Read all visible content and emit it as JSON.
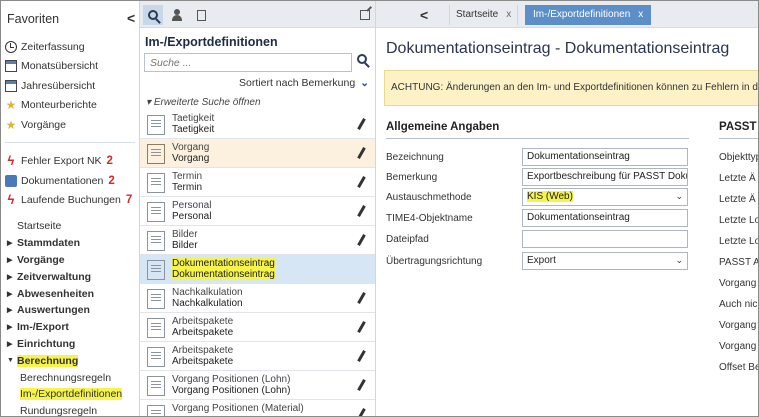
{
  "favorites": {
    "title": "Favoriten",
    "collapse": "<",
    "items": [
      {
        "label": "Zeiterfassung",
        "icon": "clock-icon"
      },
      {
        "label": "Monatsübersicht",
        "icon": "calendar-icon"
      },
      {
        "label": "Jahresübersicht",
        "icon": "calendar-icon"
      },
      {
        "label": "Monteurberichte",
        "icon": "star-icon"
      },
      {
        "label": "Vorgänge",
        "icon": "star-icon"
      }
    ],
    "alerts": [
      {
        "label": "Fehler Export NK",
        "count": "2",
        "icon": "bolt-icon"
      },
      {
        "label": "Dokumentationen",
        "count": "2",
        "icon": "documents-icon"
      },
      {
        "label": "Laufende Buchungen",
        "count": "7",
        "icon": "bolt-icon"
      }
    ]
  },
  "nav": {
    "items": [
      {
        "label": "Startseite"
      },
      {
        "label": "Stammdaten"
      },
      {
        "label": "Vorgänge"
      },
      {
        "label": "Zeitverwaltung"
      },
      {
        "label": "Abwesenheiten"
      },
      {
        "label": "Auswertungen"
      },
      {
        "label": "Im-/Export"
      },
      {
        "label": "Einrichtung"
      },
      {
        "label": "Berechnung"
      },
      {
        "label": "Berechnungsregeln"
      },
      {
        "label": "Im-/Exportdefinitionen"
      },
      {
        "label": "Rundungsregeln"
      }
    ]
  },
  "middle": {
    "title": "Im-/Exportdefinitionen",
    "search_placeholder": "Suche ...",
    "sort_label": "Sortiert nach Bemerkung",
    "sort_chevron": "⌄",
    "extended_search": "Erweiterte Suche öffnen",
    "rows": [
      {
        "line1": "Taetigkeit",
        "line2": "Taetigkeit"
      },
      {
        "line1": "Vorgang",
        "line2": "Vorgang"
      },
      {
        "line1": "Termin",
        "line2": "Termin"
      },
      {
        "line1": "Personal",
        "line2": "Personal"
      },
      {
        "line1": "Bilder",
        "line2": "Bilder"
      },
      {
        "line1": "Dokumentationseintrag",
        "line2": "Dokumentationseintrag"
      },
      {
        "line1": "Nachkalkulation",
        "line2": "Nachkalkulation"
      },
      {
        "line1": "Arbeitspakete",
        "line2": "Arbeitspakete"
      },
      {
        "line1": "Arbeitspakete",
        "line2": "Arbeitspakete"
      },
      {
        "line1": "Vorgang Positionen (Lohn)",
        "line2": "Vorgang Positionen (Lohn)"
      },
      {
        "line1": "Vorgang Positionen (Material)",
        "line2": ""
      }
    ]
  },
  "right": {
    "back": "<",
    "tabs": [
      {
        "label": "Startseite",
        "close": "x"
      },
      {
        "label": "Im-/Exportdefinitionen",
        "close": "x"
      }
    ],
    "header": "Dokumentationseintrag - Dokumentationseintrag",
    "warning": "ACHTUNG: Änderungen an den Im- und Exportdefinitionen können zu Fehlern in de",
    "section1": "Allgemeine Angaben",
    "section2": "PASST",
    "fields": [
      {
        "label": "Bezeichnung",
        "value": "Dokumentationseintrag"
      },
      {
        "label": "Bemerkung",
        "value": "Exportbeschreibung für PASST Doku"
      },
      {
        "label": "Austauschmethode",
        "value": "KIS (Web)",
        "dropdown": "⌄"
      },
      {
        "label": "TIME4-Objektname",
        "value": "Dokumentationseintrag"
      },
      {
        "label": "Dateipfad",
        "value": ""
      },
      {
        "label": "Übertragungsrichtung",
        "value": "Export",
        "dropdown": "⌄"
      }
    ],
    "right_labels": [
      "Objekttyp",
      "Letzte Ä",
      "Letzte Ä",
      "Letzte Lo",
      "Letzte Lo",
      "PASST A",
      "Vorgang",
      "Auch nic",
      "Vorgang",
      "Vorgang",
      "Offset Be"
    ]
  },
  "colors": {
    "accent_tab": "#5c8fc7",
    "highlight": "#f6f34a",
    "alert_red": "#d12b2b",
    "warning_bg": "#fcf2c6",
    "selected_row": "#d7e6f4",
    "peach_row": "#fcf1df"
  }
}
